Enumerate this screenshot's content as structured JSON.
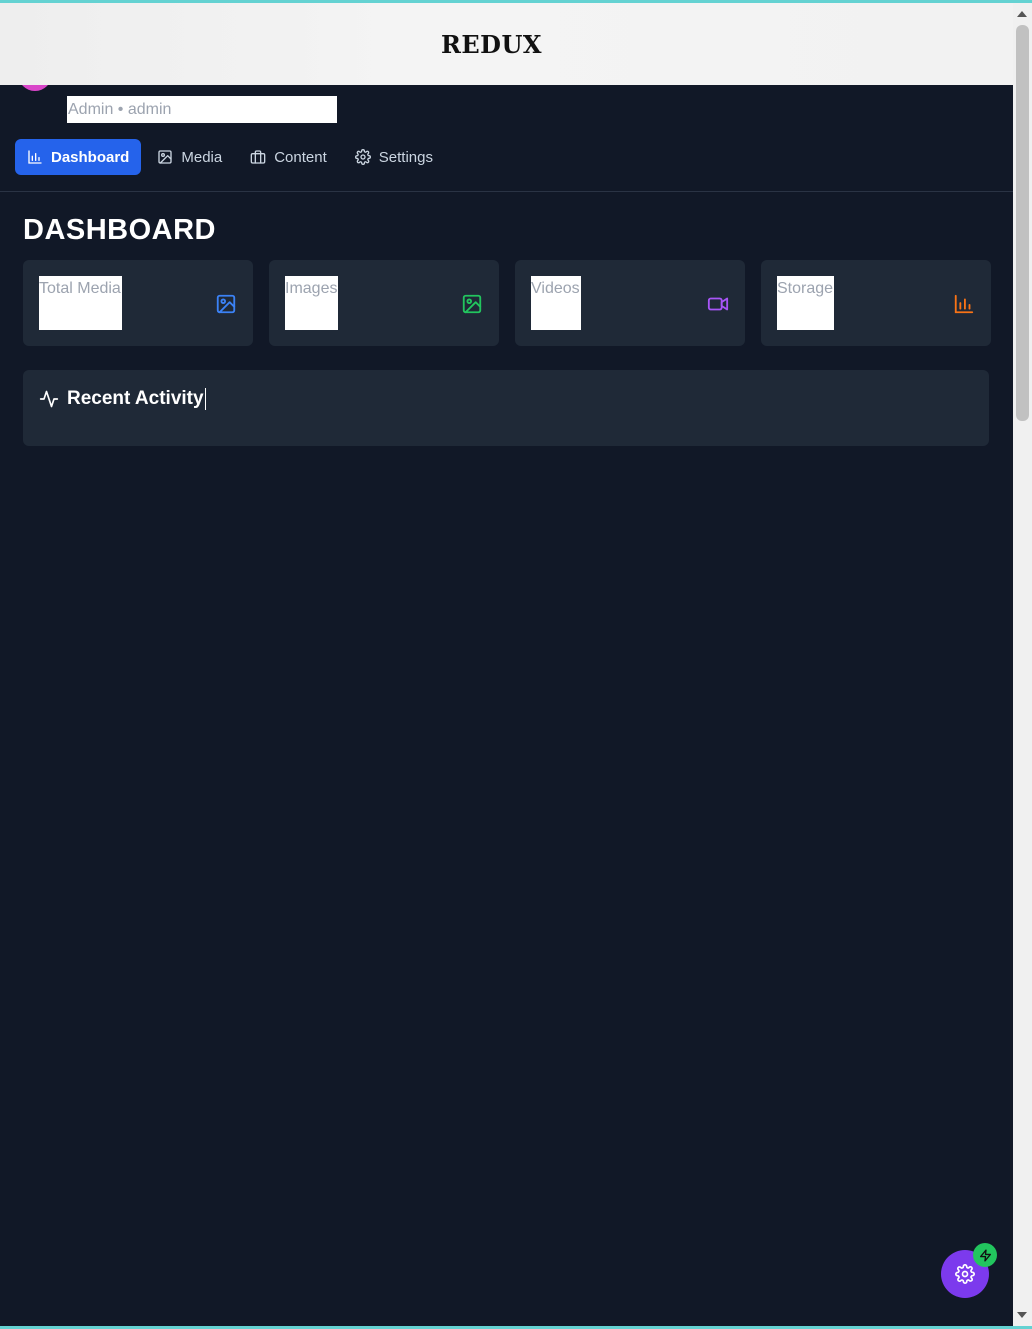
{
  "banner": {
    "title": "REDUX"
  },
  "user": {
    "line": "Admin • admin"
  },
  "nav": [
    {
      "label": "Dashboard",
      "icon": "bar-chart-icon",
      "active": true
    },
    {
      "label": "Media",
      "icon": "image-icon",
      "active": false
    },
    {
      "label": "Content",
      "icon": "briefcase-icon",
      "active": false
    },
    {
      "label": "Settings",
      "icon": "gear-icon",
      "active": false
    }
  ],
  "main": {
    "title": "DASHBOARD",
    "stats": [
      {
        "label": "Total Media",
        "icon": "image-icon",
        "color": "#3b82f6"
      },
      {
        "label": "Images",
        "icon": "image-icon",
        "color": "#22c55e"
      },
      {
        "label": "Videos",
        "icon": "video-icon",
        "color": "#a855f7"
      },
      {
        "label": "Storage",
        "icon": "bar-chart-icon",
        "color": "#f97316"
      }
    ],
    "activity": {
      "title": "Recent Activity",
      "icon": "activity-icon"
    }
  },
  "colors": {
    "accent": "#2563eb",
    "background": "#111827",
    "card": "#1f2937",
    "fab": "#7c3aed",
    "badge": "#22c55e"
  }
}
